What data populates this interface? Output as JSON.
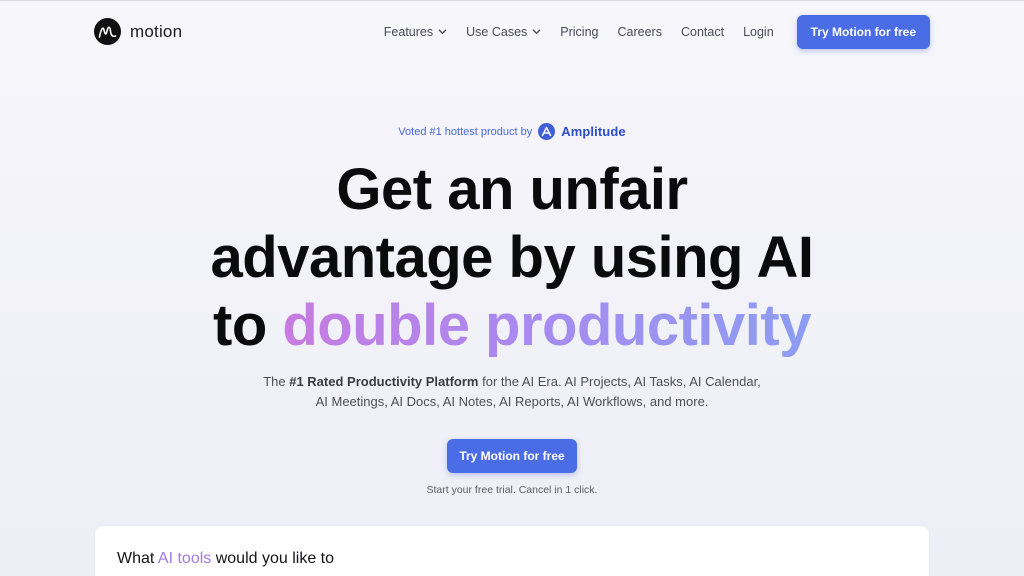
{
  "brand": {
    "name": "motion"
  },
  "nav": {
    "links": [
      {
        "label": "Features",
        "dropdown": true
      },
      {
        "label": "Use Cases",
        "dropdown": true
      },
      {
        "label": "Pricing",
        "dropdown": false
      },
      {
        "label": "Careers",
        "dropdown": false
      },
      {
        "label": "Contact",
        "dropdown": false
      },
      {
        "label": "Login",
        "dropdown": false
      }
    ],
    "cta": "Try Motion for free"
  },
  "badge": {
    "text": "Voted #1 hottest product by",
    "partner": "Amplitude"
  },
  "hero": {
    "line1": "Get an unfair",
    "line2": "advantage by using AI",
    "line3_plain": "to ",
    "line3_accent": "double productivity",
    "sub_prefix": "The ",
    "sub_bold": "#1 Rated Productivity Platform",
    "sub_rest": " for the AI Era. AI Projects, AI Tasks, AI Calendar, AI Meetings, AI Docs, AI Notes, AI Reports, AI Workflows, and more.",
    "cta": "Try Motion for free",
    "trial_note": "Start your free trial. Cancel in 1 click."
  },
  "card": {
    "title_prefix": "What ",
    "title_accent": "AI tools",
    "title_suffix": " would you like to"
  },
  "colors": {
    "primary": "#4a6ce4",
    "accent_gradient_start": "#c77be0",
    "accent_gradient_end": "#8c9df2",
    "badge_text": "#4a67d8"
  },
  "icons": {
    "logo": "motion-logo-icon",
    "dropdown": "chevron-down-icon",
    "partner": "amplitude-logo-icon"
  }
}
